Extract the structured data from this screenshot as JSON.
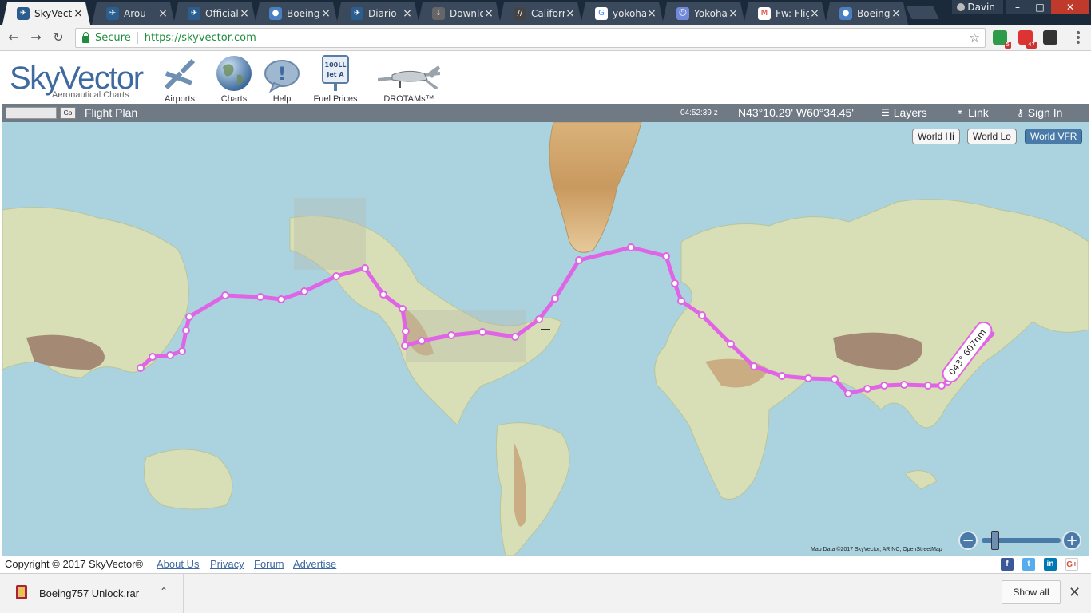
{
  "browser": {
    "tabs": [
      {
        "title": "SkyVect",
        "icon": "skyvector-icon",
        "active": true
      },
      {
        "title": "Arou",
        "icon": "skyvector-icon"
      },
      {
        "title": "Official",
        "icon": "skyvector-icon"
      },
      {
        "title": "Boeing",
        "icon": "chrome-page-icon"
      },
      {
        "title": "Diario",
        "icon": "skyvector-icon"
      },
      {
        "title": "Downlo",
        "icon": "download-icon"
      },
      {
        "title": "Californ",
        "icon": "slash-site-icon"
      },
      {
        "title": "yokoha",
        "icon": "google-icon"
      },
      {
        "title": "Yokoha",
        "icon": "discord-icon"
      },
      {
        "title": "Fw: Flig",
        "icon": "gmail-icon"
      },
      {
        "title": "Boeing",
        "icon": "chrome-page-icon"
      }
    ],
    "user": "Davin",
    "address": {
      "secure_label": "Secure",
      "url": "https://skyvector.com"
    },
    "extensions": [
      {
        "name": "extension-green-icon",
        "badge": "5",
        "color": "#2e9b4a"
      },
      {
        "name": "extension-opera-icon",
        "badge": "47",
        "color": "#d33"
      },
      {
        "name": "extension-dark-icon",
        "badge": "",
        "color": "#333"
      }
    ]
  },
  "site": {
    "logo": "SkyVector",
    "logo_sub": "Aeronautical Charts",
    "nav": [
      {
        "label": "Airports",
        "icon": "airport-icon"
      },
      {
        "label": "Charts",
        "icon": "globe-icon"
      },
      {
        "label": "Help",
        "icon": "help-icon"
      },
      {
        "label": "Fuel Prices",
        "icon": "fuel-sign-icon",
        "sign_text": "100LL Jet A"
      },
      {
        "label": "DROTAMs™",
        "icon": "drone-icon"
      }
    ]
  },
  "mapbar": {
    "go": "Go",
    "flight_plan": "Flight Plan",
    "clock": "04:52:39 z",
    "coords": "N43°10.29' W60°34.45'",
    "layers": "Layers",
    "link": "Link",
    "signin": "Sign In"
  },
  "map": {
    "layers": [
      {
        "label": "World Hi",
        "active": false
      },
      {
        "label": "World Lo",
        "active": false
      },
      {
        "label": "World VFR",
        "active": true
      }
    ],
    "route_label": "043° 607nm",
    "attribution": "Map Data ©2017 SkyVector, ARINC, OpenStreetMap",
    "route_color": "#e064e6"
  },
  "footer": {
    "copyright": "Copyright © 2017 SkyVector®",
    "links": [
      "About Us",
      "Privacy",
      "Forum",
      "Advertise"
    ],
    "social": [
      {
        "name": "facebook-icon",
        "glyph": "f",
        "color": "#3b5998"
      },
      {
        "name": "twitter-icon",
        "glyph": "t",
        "color": "#55acee"
      },
      {
        "name": "linkedin-icon",
        "glyph": "in",
        "color": "#0077b5"
      },
      {
        "name": "googleplus-icon",
        "glyph": "G+",
        "color": "#fff"
      }
    ]
  },
  "downloads": {
    "file": "Boeing757 Unlock.rar",
    "show_all": "Show all"
  }
}
